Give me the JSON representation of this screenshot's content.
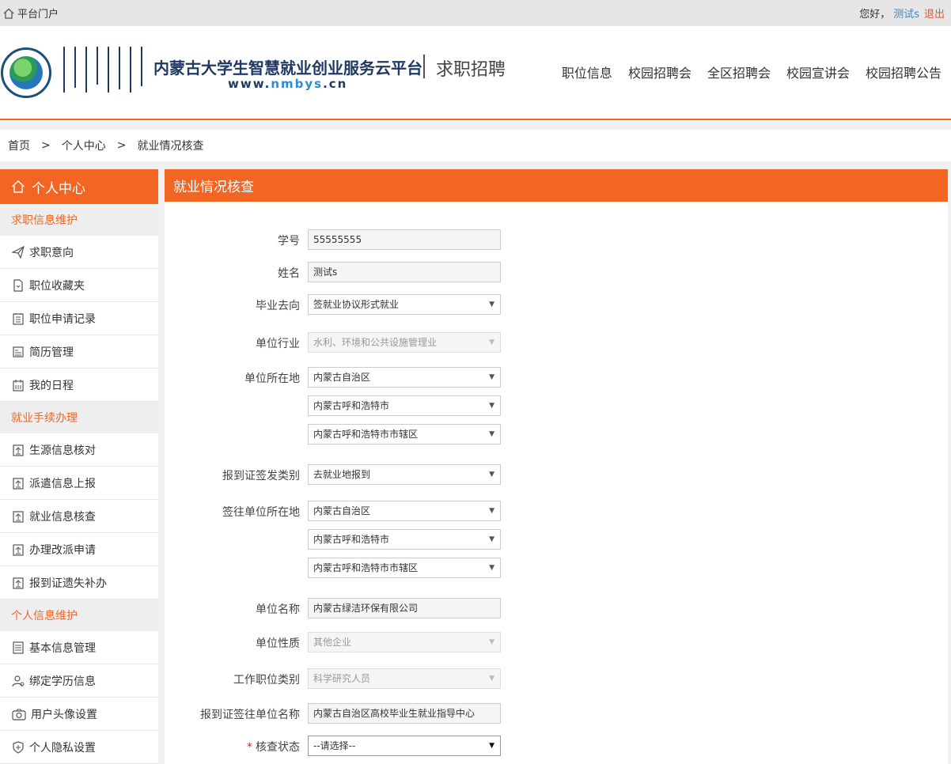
{
  "topbar": {
    "portal": "平台门户",
    "greeting": "您好，",
    "user": "测试s",
    "logout": "退出"
  },
  "header": {
    "title": "内蒙古大学生智慧就业创业服务云平台",
    "url_prefix": "www.",
    "url_highlight": "nmbys",
    "url_suffix": ".cn",
    "subtitle": "求职招聘",
    "nav": [
      "职位信息",
      "校园招聘会",
      "全区招聘会",
      "校园宣讲会",
      "校园招聘公告"
    ]
  },
  "breadcrumb": [
    "首页",
    "个人中心",
    "就业情况核查"
  ],
  "breadcrumb_sep": ">",
  "sidebar": {
    "title": "个人中心",
    "group1": "求职信息维护",
    "g1_items": [
      "求职意向",
      "职位收藏夹",
      "职位申请记录",
      "简历管理",
      "我的日程"
    ],
    "group2": "就业手续办理",
    "g2_items": [
      "生源信息核对",
      "派遣信息上报",
      "就业信息核查",
      "办理改派申请",
      "报到证遗失补办"
    ],
    "group3": "个人信息维护",
    "g3_items": [
      "基本信息管理",
      "绑定学历信息",
      "用户头像设置",
      "个人隐私设置"
    ]
  },
  "main": {
    "title": "就业情况核查",
    "labels": {
      "student_id": "学号",
      "name": "姓名",
      "destination": "毕业去向",
      "industry": "单位行业",
      "location": "单位所在地",
      "cert_type": "报到证签发类别",
      "sign_location": "签往单位所在地",
      "unit_name": "单位名称",
      "unit_nature": "单位性质",
      "job_category": "工作职位类别",
      "cert_unit_name": "报到证签往单位名称",
      "status": "核查状态"
    },
    "required_mark": "*",
    "values": {
      "student_id": "55555555",
      "name": "测试s",
      "destination": "签就业协议形式就业",
      "industry": "水利、环境和公共设施管理业",
      "loc_province": "内蒙古自治区",
      "loc_city": "内蒙古呼和浩特市",
      "loc_district": "内蒙古呼和浩特市市辖区",
      "cert_type": "去就业地报到",
      "sign_province": "内蒙古自治区",
      "sign_city": "内蒙古呼和浩特市",
      "sign_district": "内蒙古呼和浩特市市辖区",
      "unit_name": "内蒙古绿洁环保有限公司",
      "unit_nature": "其他企业",
      "job_category": "科学研究人员",
      "cert_unit_name": "内蒙古自治区高校毕业生就业指导中心",
      "status": "--请选择--"
    }
  },
  "icons": {
    "portal": "home-icon",
    "sidebar_head": "home-icon",
    "select": "caret-down-icon"
  },
  "colors": {
    "accent": "#f26522",
    "link": "#2c8ad6",
    "brand": "#1f3864"
  }
}
